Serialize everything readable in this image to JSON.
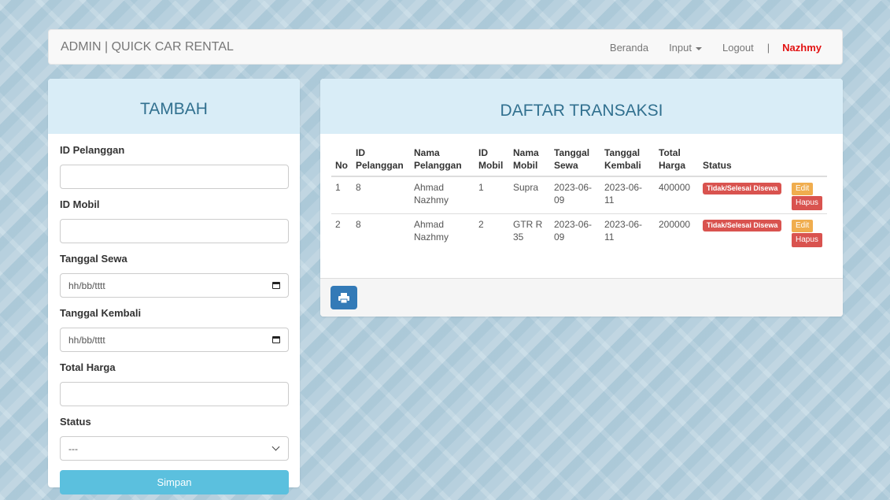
{
  "navbar": {
    "brand": "ADMIN | QUICK CAR RENTAL",
    "links": {
      "beranda": "Beranda",
      "input": "Input",
      "logout": "Logout",
      "separator": "|",
      "user": "Nazhmy"
    }
  },
  "form": {
    "title": "TAMBAH",
    "id_pelanggan_label": "ID Pelanggan",
    "id_pelanggan_value": "",
    "id_mobil_label": "ID Mobil",
    "id_mobil_value": "",
    "tanggal_sewa_label": "Tanggal Sewa",
    "tanggal_sewa_placeholder": "hh/bb/tttt",
    "tanggal_kembali_label": "Tanggal Kembali",
    "tanggal_kembali_placeholder": "hh/bb/tttt",
    "total_harga_label": "Total Harga",
    "total_harga_value": "",
    "status_label": "Status",
    "status_selected": "---",
    "submit_label": "Simpan"
  },
  "transactions": {
    "title": "DAFTAR TRANSAKSI",
    "headers": {
      "no": "No",
      "id_pelanggan_1": "ID",
      "id_pelanggan_2": "Pelanggan",
      "nama_pelanggan_1": "Nama",
      "nama_pelanggan_2": "Pelanggan",
      "id_mobil_1": "ID",
      "id_mobil_2": "Mobil",
      "nama_mobil_1": "Nama",
      "nama_mobil_2": "Mobil",
      "tanggal_sewa_1": "Tanggal",
      "tanggal_sewa_2": "Sewa",
      "tanggal_kembali_1": "Tanggal",
      "tanggal_kembali_2": "Kembali",
      "total_harga_1": "Total",
      "total_harga_2": "Harga",
      "status": "Status"
    },
    "rows": [
      {
        "no": "1",
        "id_pelanggan": "8",
        "nama_pelanggan_1": "Ahmad",
        "nama_pelanggan_2": "Nazhmy",
        "id_mobil": "1",
        "nama_mobil_1": "Supra",
        "nama_mobil_2": "",
        "tanggal_sewa_1": "2023-06-",
        "tanggal_sewa_2": "09",
        "tanggal_kembali_1": "2023-06-",
        "tanggal_kembali_2": "11",
        "total_harga": "400000",
        "status": "Tidak/Selesai Disewa",
        "edit_label": "Edit",
        "hapus_label": "Hapus"
      },
      {
        "no": "2",
        "id_pelanggan": "8",
        "nama_pelanggan_1": "Ahmad",
        "nama_pelanggan_2": "Nazhmy",
        "id_mobil": "2",
        "nama_mobil_1": "GTR R",
        "nama_mobil_2": "35",
        "tanggal_sewa_1": "2023-06-",
        "tanggal_sewa_2": "09",
        "tanggal_kembali_1": "2023-06-",
        "tanggal_kembali_2": "11",
        "total_harga": "200000",
        "status": "Tidak/Selesai Disewa",
        "edit_label": "Edit",
        "hapus_label": "Hapus"
      }
    ]
  },
  "icons": {
    "print": "print-icon",
    "calendar": "calendar-icon",
    "dropdown": "chevron-down-icon",
    "caret": "caret-down-icon"
  },
  "colors": {
    "accent_info": "#5bc0de",
    "heading_bg": "#d9edf7",
    "heading_text": "#31708f",
    "danger": "#d9534f",
    "warning": "#f0ad4e",
    "primary": "#337ab7",
    "user_name": "#e21212"
  }
}
